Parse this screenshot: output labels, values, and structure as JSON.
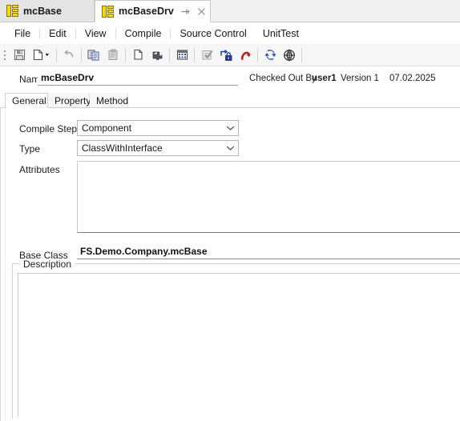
{
  "window": {
    "tabs": [
      {
        "label": "mcBase",
        "icon": "class-block-icon",
        "active": false,
        "pinned": false,
        "closable": false
      },
      {
        "label": "mcBaseDrv",
        "icon": "class-block-icon",
        "active": true,
        "pinned": true,
        "closable": true
      }
    ],
    "pin_icon": "pin-icon",
    "close_icon": "close-icon"
  },
  "menubar": {
    "items": [
      {
        "label": "File"
      },
      {
        "label": "Edit"
      },
      {
        "label": "View"
      },
      {
        "label": "Compile"
      },
      {
        "label": "Source Control"
      },
      {
        "label": "UnitTest"
      }
    ]
  },
  "toolbar": {
    "buttons": [
      {
        "name": "save-button",
        "icon": "floppy-disk-icon",
        "enabled": true,
        "has_dropdown": false
      },
      {
        "name": "new-button",
        "icon": "new-document-icon",
        "enabled": true,
        "has_dropdown": true
      },
      {
        "name": "undo-button",
        "icon": "undo-arrow-icon",
        "enabled": false,
        "has_dropdown": false
      },
      {
        "name": "copy-button",
        "icon": "copy-icon",
        "enabled": true,
        "has_dropdown": false
      },
      {
        "name": "paste-button",
        "icon": "paste-icon",
        "enabled": false,
        "has_dropdown": false
      },
      {
        "name": "duplicate-button",
        "icon": "duplicate-page-icon",
        "enabled": true,
        "has_dropdown": false
      },
      {
        "name": "plugin-button",
        "icon": "puzzle-piece-icon",
        "enabled": true,
        "has_dropdown": false
      },
      {
        "name": "grid-button",
        "icon": "table-grid-icon",
        "enabled": true,
        "has_dropdown": false
      },
      {
        "name": "check-button",
        "icon": "checklist-icon",
        "enabled": false,
        "has_dropdown": false
      },
      {
        "name": "check-in-button",
        "icon": "check-in-lock-icon",
        "enabled": true,
        "has_dropdown": false
      },
      {
        "name": "undo-checkout-button",
        "icon": "red-undo-icon",
        "enabled": true,
        "has_dropdown": false
      },
      {
        "name": "refresh-button",
        "icon": "refresh-sync-icon",
        "enabled": true,
        "has_dropdown": false
      },
      {
        "name": "target-button",
        "icon": "target-globe-icon",
        "enabled": true,
        "has_dropdown": false
      }
    ]
  },
  "header": {
    "name_label": "Name",
    "name_value": "mcBaseDrv",
    "name_placeholder": "",
    "checked_out_by_label": "Checked Out By",
    "checked_out_by_user": "user1",
    "version_label": "Version 1",
    "date": "07.02.2025"
  },
  "inner_tabs": [
    {
      "label": "General",
      "active": true
    },
    {
      "label": "Property",
      "active": false
    },
    {
      "label": "Method",
      "active": false
    }
  ],
  "form": {
    "compile_step": {
      "label": "Compile Step",
      "value": "Component",
      "options": [
        "Component"
      ]
    },
    "type": {
      "label": "Type",
      "value": "ClassWithInterface",
      "options": [
        "ClassWithInterface"
      ]
    },
    "attributes": {
      "label": "Attributes",
      "value": "",
      "placeholder": ""
    },
    "base_class": {
      "label": "Base Class",
      "value": "FS.Demo.Company.mcBase",
      "placeholder": ""
    },
    "description": {
      "label": "Description",
      "value": "",
      "placeholder": ""
    }
  },
  "colors": {
    "accent_yellow": "#ffd700",
    "lock_blue": "#1a3fa0",
    "undo_red": "#c0211d",
    "sync_blue": "#1f4fbf",
    "window_bg": "#ffffff",
    "chrome_bg": "#f0f0f0",
    "toolbar_bg": "#f6f6f6"
  }
}
